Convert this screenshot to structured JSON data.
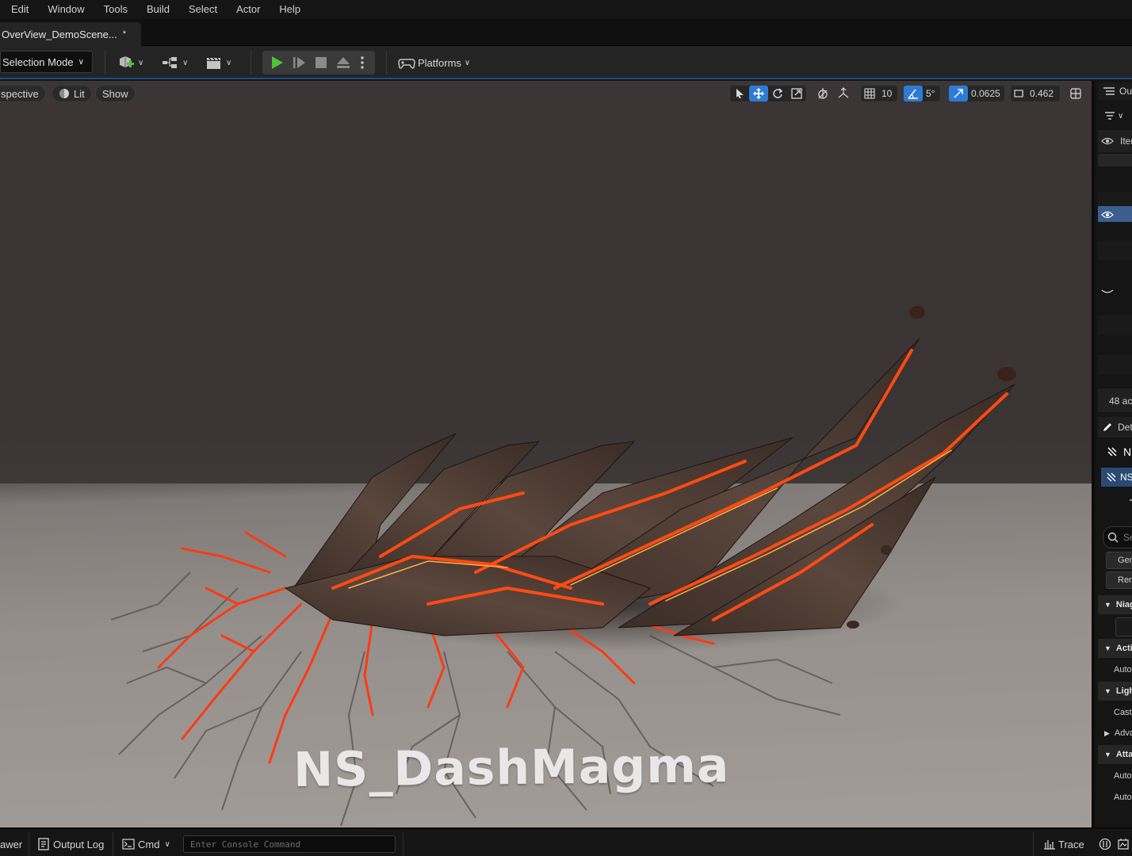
{
  "menu": {
    "items": [
      "Edit",
      "Window",
      "Tools",
      "Build",
      "Select",
      "Actor",
      "Help"
    ]
  },
  "document_tab": {
    "title": "OverView_DemoScene...",
    "dirty_marker": "*"
  },
  "toolbar": {
    "selection_mode": "Selection Mode",
    "platforms": "Platforms",
    "play_color": "#4fc13a"
  },
  "viewport": {
    "perspective_label": "spective",
    "lit_label": "Lit",
    "show_label": "Show",
    "grid_snap_value": "10",
    "rotation_snap_value": "5°",
    "scale_snap_value": "0.0625",
    "camera_speed_value": "0.462",
    "accent_color": "#2d7bd6",
    "overlay_text": "NS_DashMagma"
  },
  "outliner": {
    "tab_label": "Out",
    "column_label": "Iter",
    "actor_count": "48 ac"
  },
  "details": {
    "tab_label": "Det",
    "component_title": "N",
    "selected_component": "NS",
    "search_placeholder": "Se",
    "filter_buttons": [
      "Gene",
      "Rend"
    ],
    "sections": [
      {
        "label": "Niag",
        "expanded": true
      },
      {
        "label": "Activ",
        "expanded": true
      },
      {
        "label": "Auto",
        "is_property": true
      },
      {
        "label": "Light",
        "expanded": true
      },
      {
        "label": "Cast",
        "is_property": true
      },
      {
        "label": "Adva",
        "expanded": false
      },
      {
        "label": "Attac",
        "expanded": true
      },
      {
        "label": "Auto",
        "is_property": true
      },
      {
        "label": "Auto",
        "is_property": true
      }
    ]
  },
  "statusbar": {
    "content_drawer": "awer",
    "output_log": "Output Log",
    "cmd": "Cmd",
    "console_placeholder": "Enter Console Command",
    "trace": "Trace"
  }
}
